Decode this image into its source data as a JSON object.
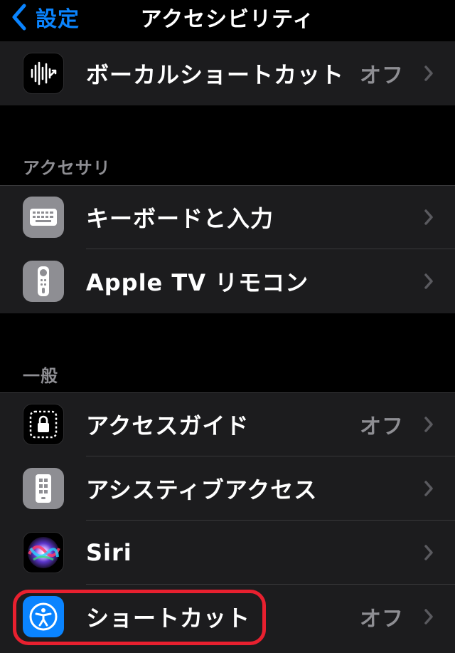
{
  "nav": {
    "back_label": "設定",
    "title": "アクセシビリティ"
  },
  "group_top": {
    "items": [
      {
        "label": "ボーカルショートカット",
        "value": "オフ",
        "icon": "waveform-icon"
      }
    ]
  },
  "accessories": {
    "header": "アクセサリ",
    "items": [
      {
        "label": "キーボードと入力",
        "value": "",
        "icon": "keyboard-icon"
      },
      {
        "label": "Apple TV リモコン",
        "value": "",
        "icon": "remote-icon"
      }
    ]
  },
  "general": {
    "header": "一般",
    "items": [
      {
        "label": "アクセスガイド",
        "value": "オフ",
        "icon": "lock-guided-access-icon"
      },
      {
        "label": "アシスティブアクセス",
        "value": "",
        "icon": "assistive-access-icon"
      },
      {
        "label": "Siri",
        "value": "",
        "icon": "siri-icon"
      },
      {
        "label": "ショートカット",
        "value": "オフ",
        "icon": "accessibility-person-icon"
      }
    ]
  },
  "colors": {
    "accent": "#0a84ff",
    "background": "#000000",
    "cell": "#1c1c1e",
    "secondary_text": "#8e8e93",
    "highlight_ring": "#e8202f"
  }
}
